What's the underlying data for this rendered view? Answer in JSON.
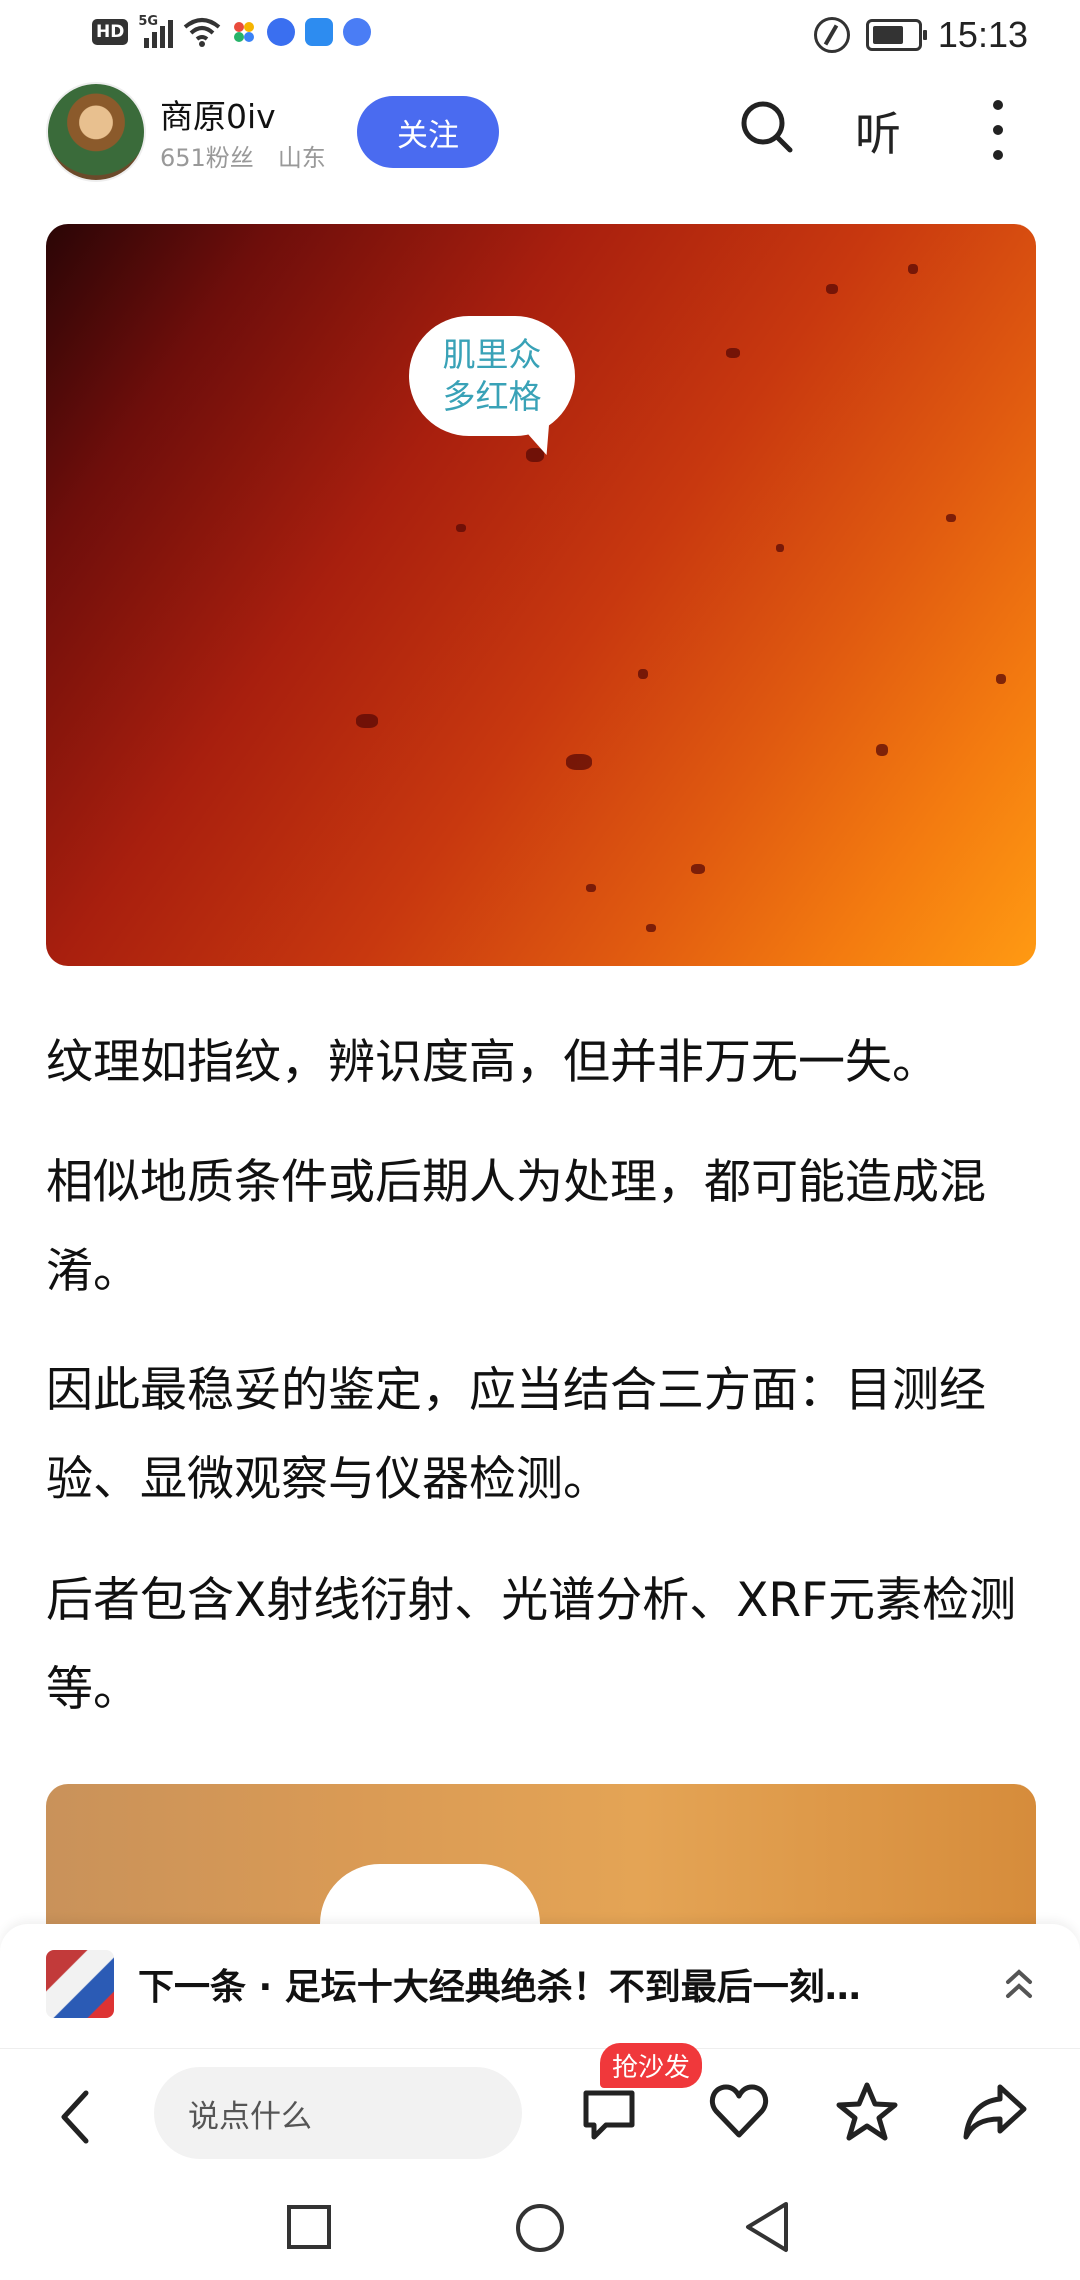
{
  "status_bar": {
    "left_icons": [
      "hd-icon",
      "5g-signal-icon",
      "wifi-icon",
      "app-icon-pinwheel",
      "app-icon-blue-1",
      "app-icon-cloud",
      "app-icon-blue-2"
    ],
    "hd_label": "HD",
    "network_label": "5G",
    "time": "15:13"
  },
  "header": {
    "author_name": "商原0iv",
    "followers": "651粉丝",
    "location": "山东",
    "follow_label": "关注",
    "listen_label": "听"
  },
  "article": {
    "image1_bubble_line1": "肌里众",
    "image1_bubble_line2": "多红格",
    "paragraphs": [
      "纹理如指纹，辨识度高，但并非万无一失。",
      "相似地质条件或后期人为处理，都可能造成混淆。",
      "因此最稳妥的鉴定，应当结合三方面：目测经验、显微观察与仪器检测。",
      "后者包含X射线衍射、光谱分析、XRF元素检测等。"
    ]
  },
  "next_bar": {
    "title": "下一条 · 足坛十大经典绝杀！不到最后一刻…"
  },
  "action_bar": {
    "comment_placeholder": "说点什么",
    "sofa_badge": "抢沙发"
  },
  "colors": {
    "accent": "#4a6bf0",
    "badge": "#f0383b",
    "bubble_text": "#39a2b7"
  }
}
